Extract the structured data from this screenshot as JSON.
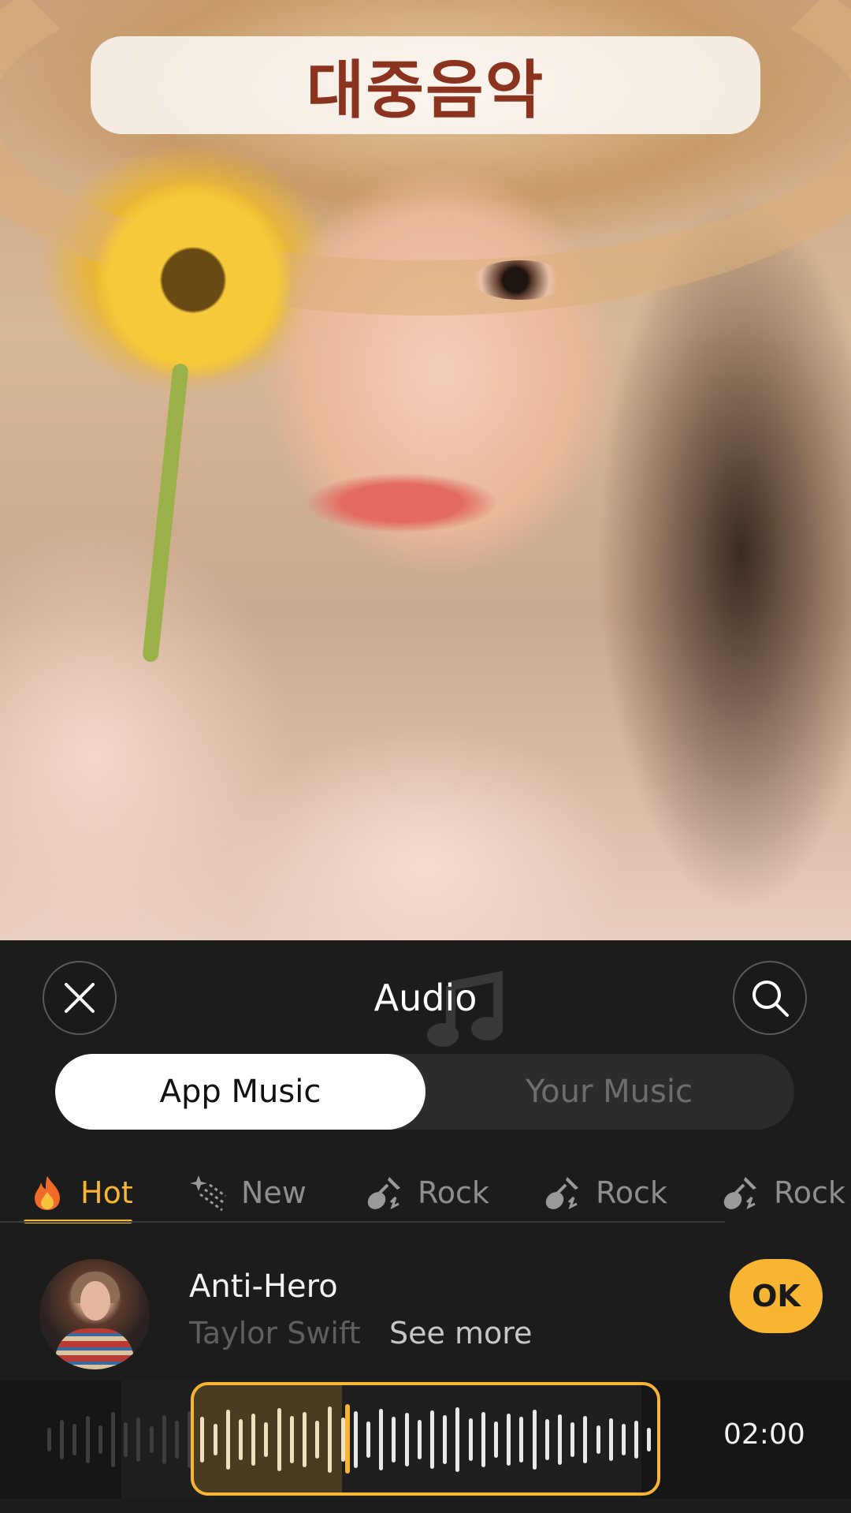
{
  "overlay": {
    "title": "대중음악"
  },
  "header": {
    "title": "Audio",
    "close_icon": "close-icon",
    "search_icon": "search-icon"
  },
  "tabs": [
    {
      "label": "App Music",
      "active": true
    },
    {
      "label": "Your Music",
      "active": false
    }
  ],
  "categories": [
    {
      "label": "Hot",
      "icon": "fire-icon",
      "active": true
    },
    {
      "label": "New",
      "icon": "sparkle-icon",
      "active": false
    },
    {
      "label": "Rock",
      "icon": "guitar-icon",
      "active": false
    },
    {
      "label": "Rock",
      "icon": "guitar-icon",
      "active": false
    },
    {
      "label": "Rock",
      "icon": "guitar-icon",
      "active": false
    }
  ],
  "track": {
    "title": "Anti-Hero",
    "artist": "Taylor Swift",
    "see_more": "See more",
    "ok_label": "OK"
  },
  "waveform": {
    "time": "02:00"
  },
  "colors": {
    "accent": "#f7b531",
    "panel_bg": "#1c1c1c",
    "title_text": "#8a3420"
  }
}
